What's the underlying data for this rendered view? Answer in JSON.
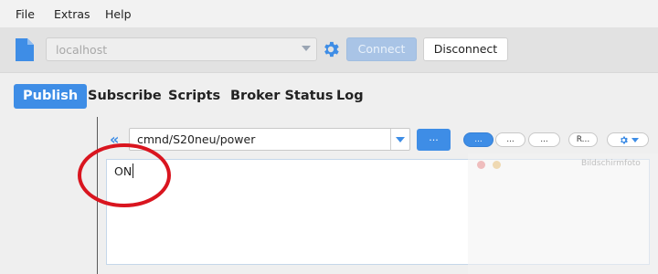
{
  "menu": {
    "file": "File",
    "extras": "Extras",
    "help": "Help"
  },
  "toolbar": {
    "host_value": "localhost",
    "connect_label": "Connect",
    "disconnect_label": "Disconnect"
  },
  "tabs": [
    {
      "label": "Publish"
    },
    {
      "label": "Subscribe"
    },
    {
      "label": "Scripts"
    },
    {
      "label": "Broker Status"
    },
    {
      "label": "Log"
    }
  ],
  "publish": {
    "topic_value": "cmnd/S20neu/power",
    "ellipsis_button": "...",
    "pill_buttons": [
      "...",
      "...",
      "...",
      "R..."
    ],
    "payload_text": "ON"
  },
  "overlay": {
    "ghost_text": "Bildschirmfoto"
  },
  "colors": {
    "accent": "#3e8de6",
    "annotation": "#d9151f"
  }
}
